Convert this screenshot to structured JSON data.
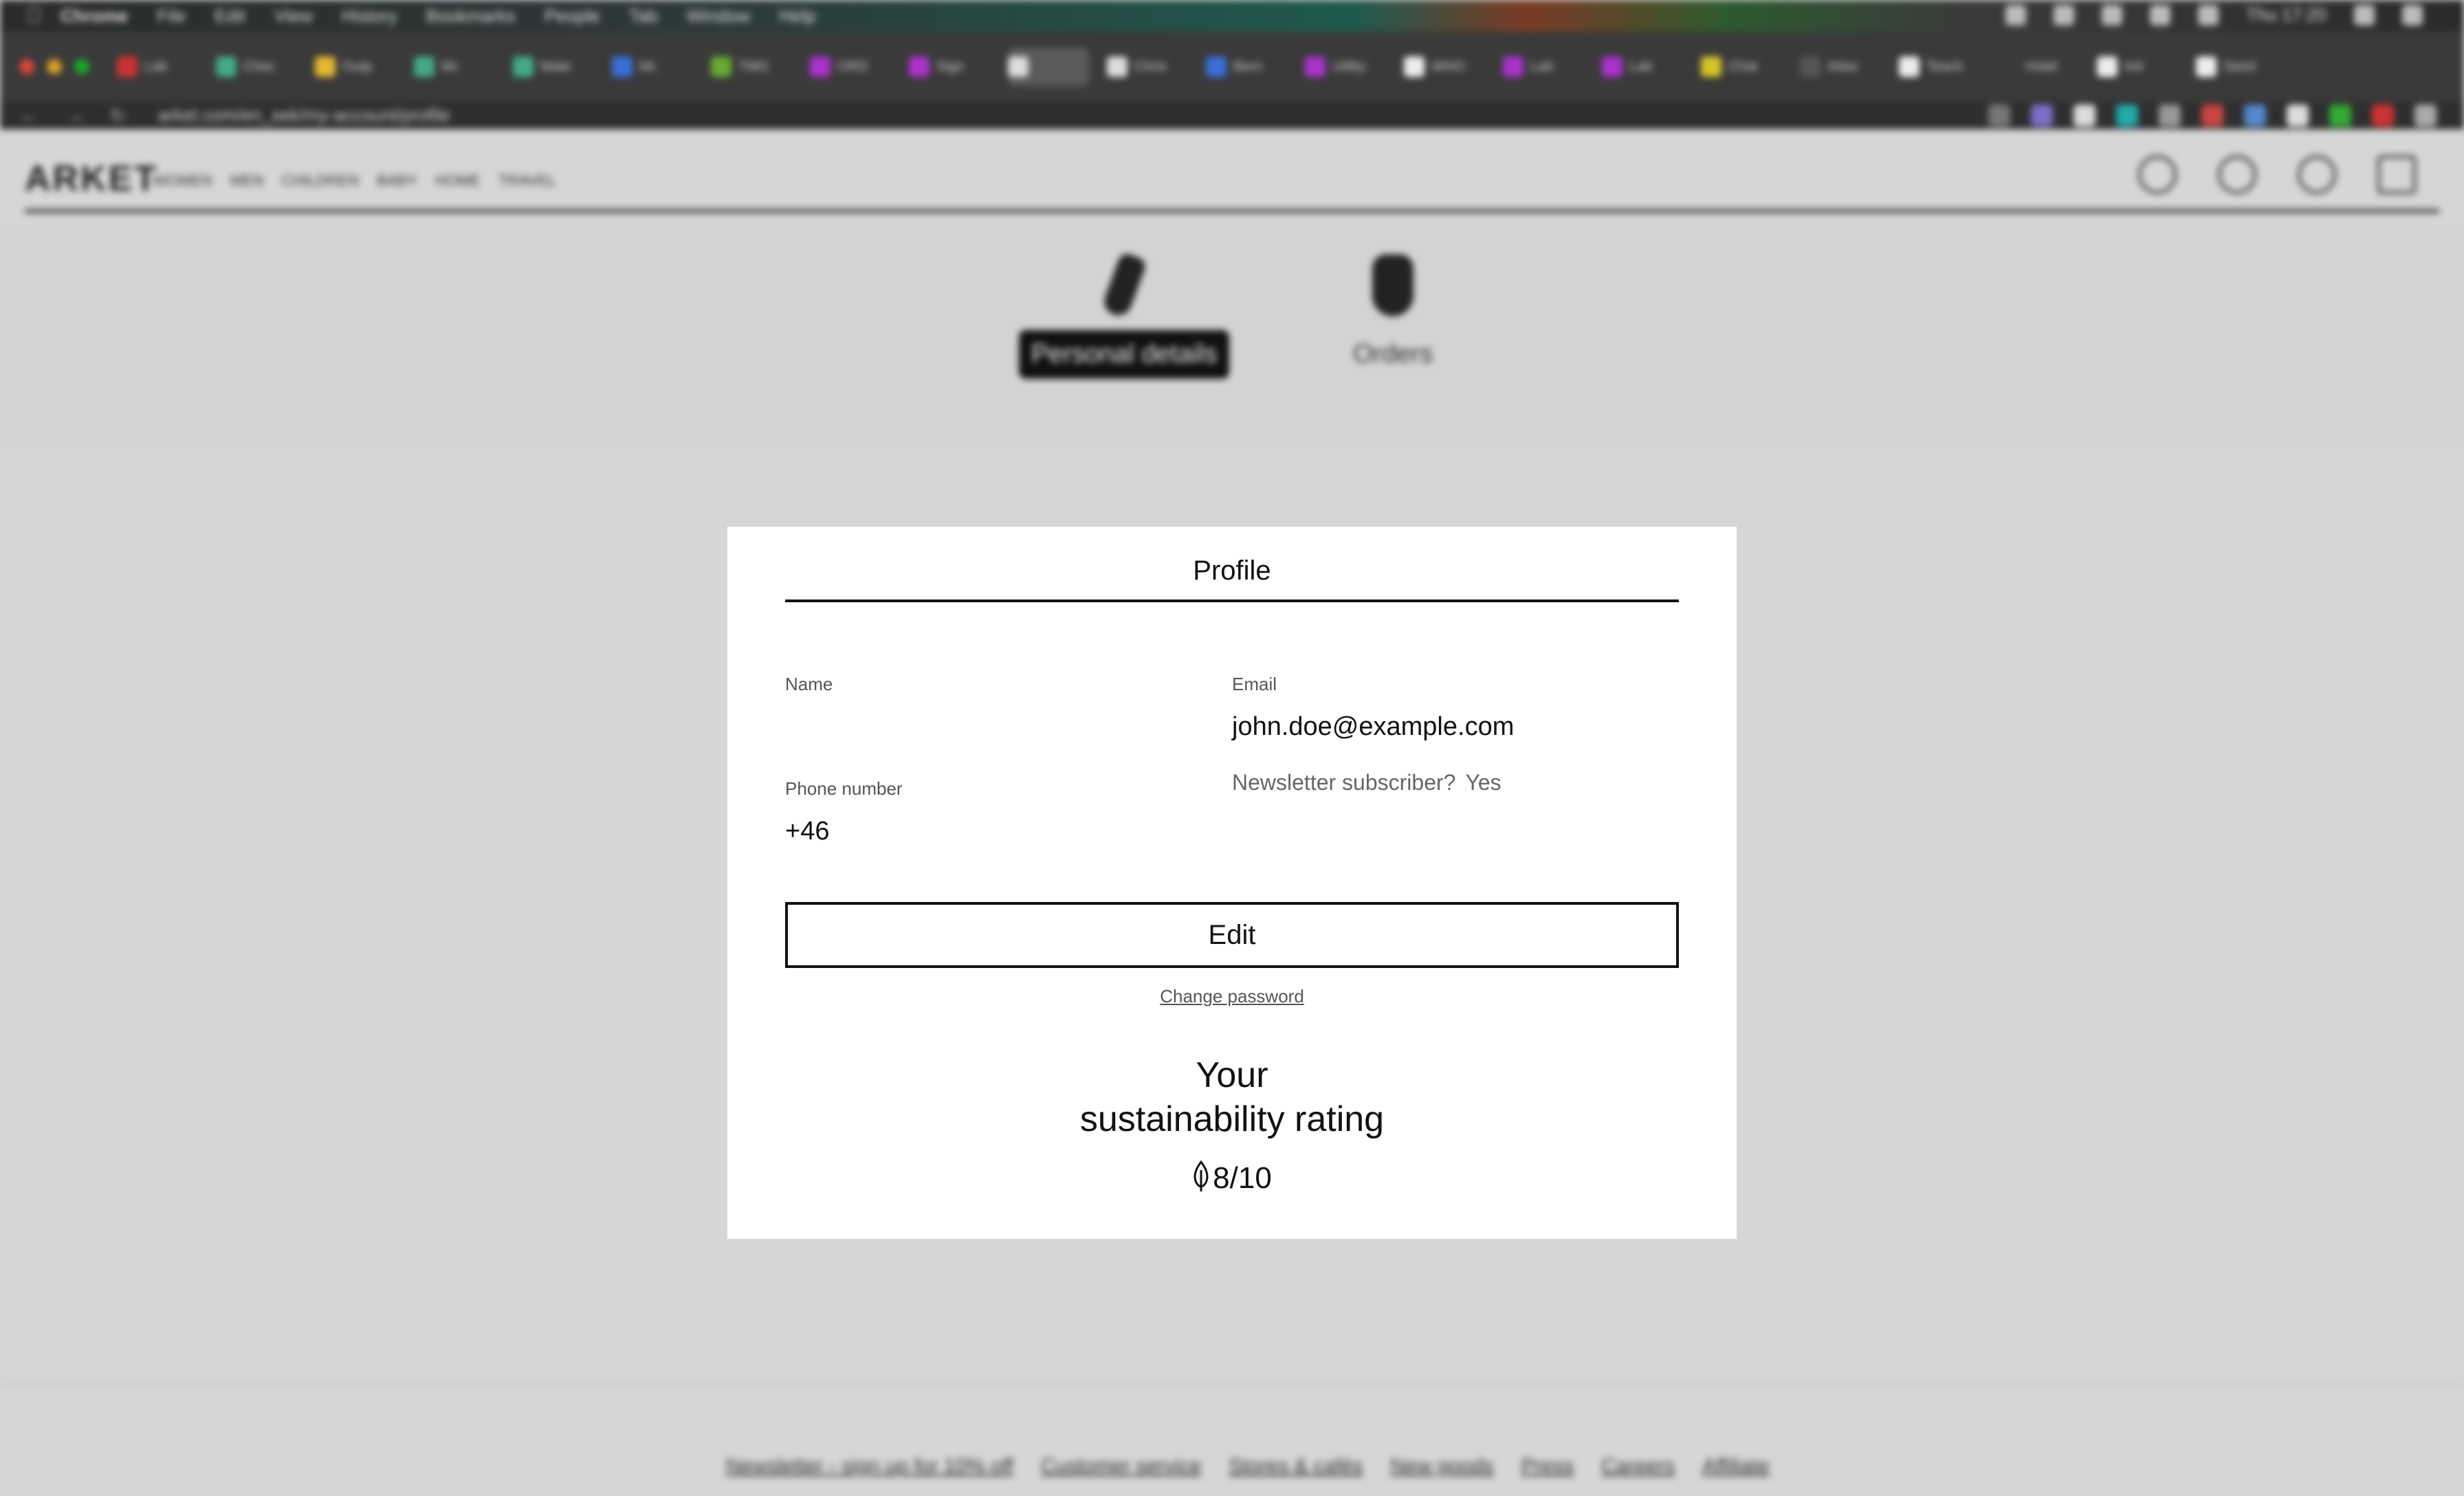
{
  "browser": {
    "menu": [
      "Chrome",
      "File",
      "Edit",
      "View",
      "History",
      "Bookmarks",
      "People",
      "Tab",
      "Window",
      "Help"
    ],
    "tabs": [
      "Lab",
      "Chec",
      "Outp",
      "Mr.",
      "Mate",
      "Mr.",
      "TMG",
      "ORD",
      "Sign",
      "",
      "Chris",
      "Bern",
      "Utility",
      "WHO",
      "Lab",
      "Lab",
      "Chat",
      "Atlas",
      "Teach",
      "Hotel",
      "Intr",
      "Seed"
    ],
    "clock": "Thu 17:20",
    "url": "arket.com/en_sek/my-account/profile"
  },
  "site": {
    "logo": "ARKET",
    "nav": [
      "WOMEN",
      "MEN",
      "CHILDREN",
      "BABY",
      "HOME",
      "TRAVEL"
    ],
    "account_tabs": [
      {
        "label": "Personal details",
        "active": true
      },
      {
        "label": "Orders",
        "active": false
      }
    ],
    "footer_links": [
      "Newsletter - sign up for 10% off",
      "Customer service",
      "Stores & cafés",
      "New goods",
      "Press",
      "Careers",
      "Affiliate"
    ]
  },
  "profile": {
    "title": "Profile",
    "name_label": "Name",
    "name_value": "",
    "email_label": "Email",
    "email_value": "john.doe@example.com",
    "newsletter_label": "Newsletter subscriber?",
    "newsletter_value": "Yes",
    "phone_label": "Phone number",
    "phone_value": "+46",
    "edit_label": "Edit",
    "change_password_label": "Change password",
    "sustainability_line1": "Your",
    "sustainability_line2": "sustainability rating",
    "sustainability_rating": "8/10"
  },
  "colors": {
    "overlay": "#d6d6d6",
    "card": "#ffffff",
    "accent": "#111111"
  }
}
